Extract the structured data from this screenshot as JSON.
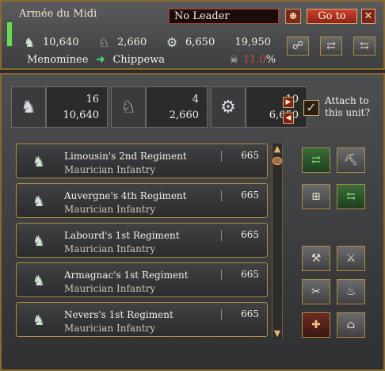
{
  "header": {
    "army_name": "Armée du Midi",
    "leader": "No Leader",
    "goto_label": "Go to",
    "close_label": "✕",
    "stats": {
      "infantry": "10,640",
      "cavalry": "2,660",
      "artillery": "6,650",
      "total": "19,950"
    },
    "route": {
      "from": "Menominee",
      "to": "Chippewa"
    },
    "attrition": {
      "value": "11.0",
      "suffix": "%"
    }
  },
  "summary": {
    "infantry": {
      "regiments": "16",
      "men": "10,640"
    },
    "cavalry": {
      "regiments": "4",
      "men": "2,660"
    },
    "artillery": {
      "regiments": "10",
      "men": "6,650"
    },
    "attach_label": "Attach to this unit?",
    "attach_checked": true
  },
  "regiments": [
    {
      "name": "Limousin's 2nd Regiment",
      "type": "Maurician Infantry",
      "count": "665"
    },
    {
      "name": "Auvergne's 4th Regiment",
      "type": "Maurician Infantry",
      "count": "665"
    },
    {
      "name": "Labourd's 1st Regiment",
      "type": "Maurician Infantry",
      "count": "665"
    },
    {
      "name": "Armagnac's 1st Regiment",
      "type": "Maurician Infantry",
      "count": "665"
    },
    {
      "name": "Nevers's 1st Regiment",
      "type": "Maurician Infantry",
      "count": "665"
    }
  ],
  "icons": {
    "leader": "portrait-icon",
    "infantry": "infantry-icon",
    "cavalry": "cavalry-icon",
    "artillery": "artillery-icon",
    "skull": "skull-icon"
  }
}
